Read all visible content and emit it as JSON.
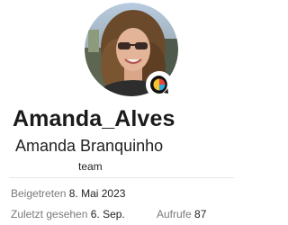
{
  "profile": {
    "username": "Amanda_Alves",
    "full_name": "Amanda Branquinho",
    "title": "team",
    "avatar_icon": "user-photo",
    "status_icon": "chat-bubble-icon"
  },
  "stats": {
    "joined_label": "Beigetreten",
    "joined_value": "8. Mai 2023",
    "last_seen_label": "Zuletzt gesehen",
    "last_seen_value": "6. Sep.",
    "views_label": "Aufrufe",
    "views_value": "87"
  },
  "colors": {
    "badge_red": "#e8453c",
    "badge_yellow": "#f4c430",
    "badge_blue": "#2fa8e0",
    "badge_dark": "#111111"
  }
}
